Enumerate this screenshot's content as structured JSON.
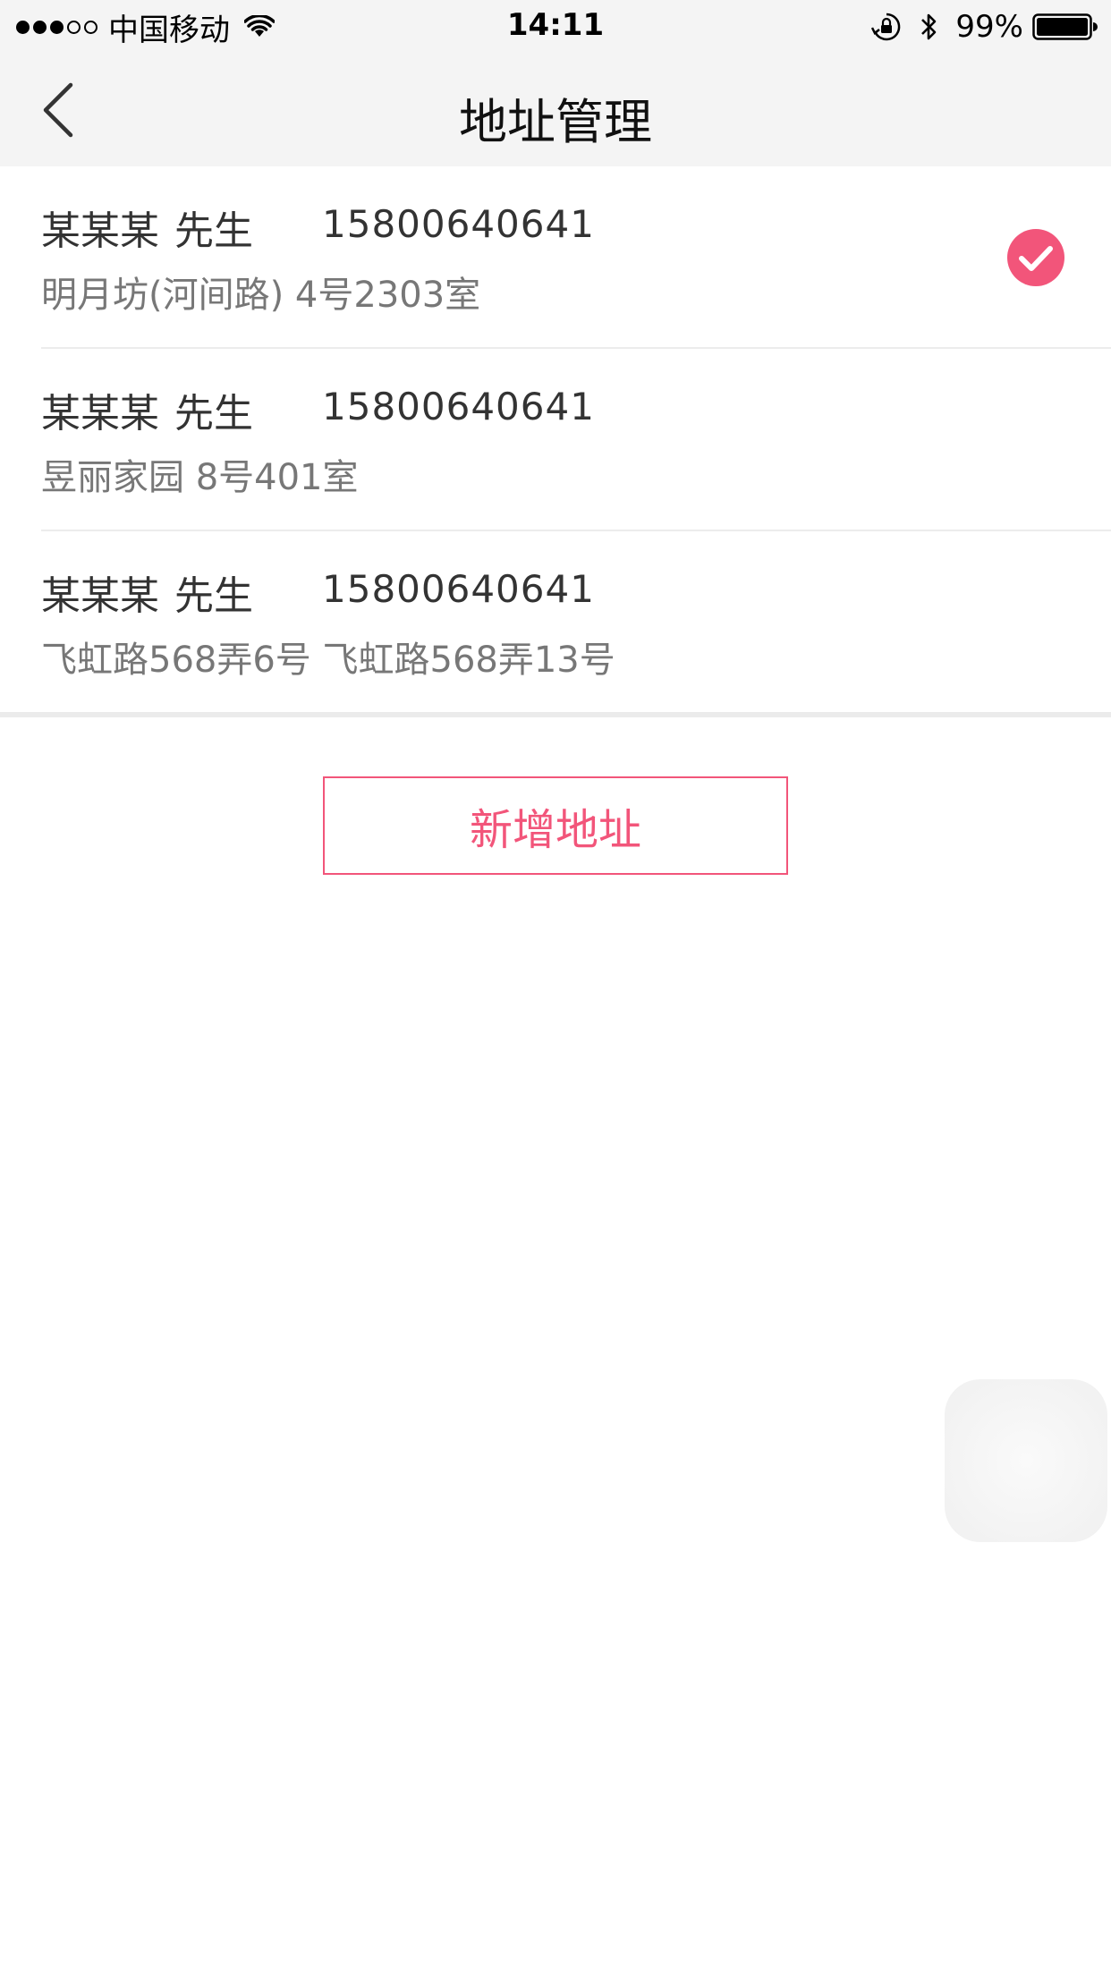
{
  "status_bar": {
    "carrier": "中国移动",
    "time": "14:11",
    "battery": "99%",
    "signal_bars_filled": 3,
    "signal_bars_total": 5
  },
  "nav": {
    "title": "地址管理",
    "back_icon": "chevron-left-icon"
  },
  "addresses": [
    {
      "name": "某某某",
      "title": "先生",
      "phone": "15800640641",
      "address": "明月坊(河间路) 4号2303室",
      "selected": true
    },
    {
      "name": "某某某",
      "title": "先生",
      "phone": "15800640641",
      "address": "昱丽家园 8号401室",
      "selected": false
    },
    {
      "name": "某某某",
      "title": "先生",
      "phone": "15800640641",
      "address": "飞虹路568弄6号 飞虹路568弄13号",
      "selected": false
    }
  ],
  "add_button": {
    "label": "新增地址"
  },
  "colors": {
    "accent": "#f2557a",
    "bar_background": "#f4f4f4",
    "primary_text": "#333333",
    "secondary_text": "#777777"
  }
}
